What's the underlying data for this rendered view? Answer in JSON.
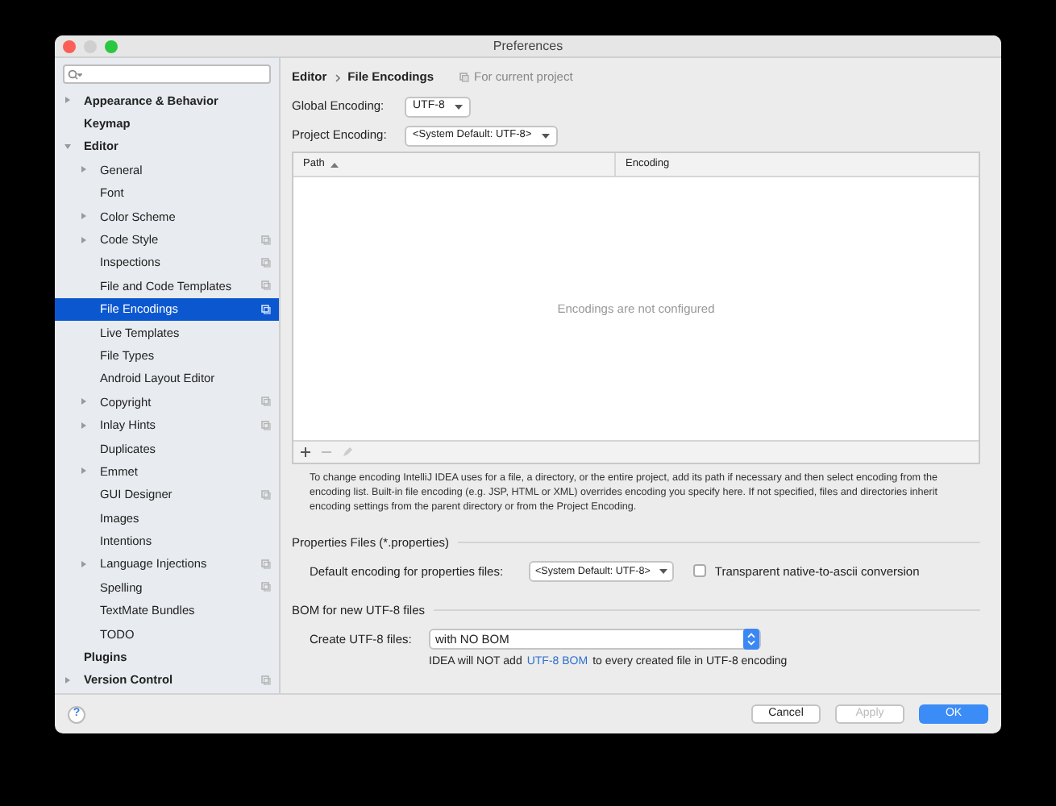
{
  "window": {
    "title": "Preferences"
  },
  "sidebar": {
    "items": [
      {
        "label": "Appearance & Behavior",
        "kind": "expandable",
        "expanded": false,
        "bold": true,
        "project_scoped": false,
        "selected": false
      },
      {
        "label": "Keymap",
        "kind": "leaf",
        "bold": true,
        "project_scoped": false,
        "selected": false
      },
      {
        "label": "Editor",
        "kind": "expandable",
        "expanded": true,
        "bold": true,
        "project_scoped": false,
        "selected": false,
        "children": [
          {
            "label": "General",
            "kind": "expandable",
            "expanded": false,
            "bold": false,
            "project_scoped": false,
            "selected": false
          },
          {
            "label": "Font",
            "kind": "leaf",
            "bold": false,
            "project_scoped": false,
            "selected": false
          },
          {
            "label": "Color Scheme",
            "kind": "expandable",
            "expanded": false,
            "bold": false,
            "project_scoped": false,
            "selected": false
          },
          {
            "label": "Code Style",
            "kind": "expandable",
            "expanded": false,
            "bold": false,
            "project_scoped": true,
            "selected": false
          },
          {
            "label": "Inspections",
            "kind": "leaf",
            "bold": false,
            "project_scoped": true,
            "selected": false
          },
          {
            "label": "File and Code Templates",
            "kind": "leaf",
            "bold": false,
            "project_scoped": true,
            "selected": false
          },
          {
            "label": "File Encodings",
            "kind": "leaf",
            "bold": false,
            "project_scoped": true,
            "selected": true
          },
          {
            "label": "Live Templates",
            "kind": "leaf",
            "bold": false,
            "project_scoped": false,
            "selected": false
          },
          {
            "label": "File Types",
            "kind": "leaf",
            "bold": false,
            "project_scoped": false,
            "selected": false
          },
          {
            "label": "Android Layout Editor",
            "kind": "leaf",
            "bold": false,
            "project_scoped": false,
            "selected": false
          },
          {
            "label": "Copyright",
            "kind": "expandable",
            "expanded": false,
            "bold": false,
            "project_scoped": true,
            "selected": false
          },
          {
            "label": "Inlay Hints",
            "kind": "expandable",
            "expanded": false,
            "bold": false,
            "project_scoped": true,
            "selected": false
          },
          {
            "label": "Duplicates",
            "kind": "leaf",
            "bold": false,
            "project_scoped": false,
            "selected": false
          },
          {
            "label": "Emmet",
            "kind": "expandable",
            "expanded": false,
            "bold": false,
            "project_scoped": false,
            "selected": false
          },
          {
            "label": "GUI Designer",
            "kind": "leaf",
            "bold": false,
            "project_scoped": true,
            "selected": false
          },
          {
            "label": "Images",
            "kind": "leaf",
            "bold": false,
            "project_scoped": false,
            "selected": false
          },
          {
            "label": "Intentions",
            "kind": "leaf",
            "bold": false,
            "project_scoped": false,
            "selected": false
          },
          {
            "label": "Language Injections",
            "kind": "expandable",
            "expanded": false,
            "bold": false,
            "project_scoped": true,
            "selected": false
          },
          {
            "label": "Spelling",
            "kind": "leaf",
            "bold": false,
            "project_scoped": true,
            "selected": false
          },
          {
            "label": "TextMate Bundles",
            "kind": "leaf",
            "bold": false,
            "project_scoped": false,
            "selected": false
          },
          {
            "label": "TODO",
            "kind": "leaf",
            "bold": false,
            "project_scoped": false,
            "selected": false
          }
        ]
      },
      {
        "label": "Plugins",
        "kind": "leaf",
        "bold": true,
        "project_scoped": false,
        "selected": false
      },
      {
        "label": "Version Control",
        "kind": "expandable",
        "expanded": false,
        "bold": true,
        "project_scoped": true,
        "selected": false
      }
    ]
  },
  "breadcrumb": [
    "Editor",
    "File Encodings"
  ],
  "scope_note": "For current project",
  "global_encoding": {
    "label": "Global Encoding:",
    "value": "UTF-8"
  },
  "project_encoding": {
    "label": "Project Encoding:",
    "value": "<System Default: UTF-8>"
  },
  "table": {
    "columns": [
      "Path",
      "Encoding"
    ],
    "empty_text": "Encodings are not configured"
  },
  "description": "To change encoding IntelliJ IDEA uses for a file, a directory, or the entire project, add its path if necessary and then select encoding from the encoding list. Built-in file encoding (e.g. JSP, HTML or XML) overrides encoding you specify here. If not specified, files and directories inherit encoding settings from the parent directory or from the Project Encoding.",
  "properties": {
    "title": "Properties Files (*.properties)",
    "label": "Default encoding for properties files:",
    "value": "<System Default: UTF-8>",
    "checkbox": {
      "label": "Transparent native-to-ascii conversion",
      "checked": false
    }
  },
  "bom": {
    "title": "BOM for new UTF-8 files",
    "label": "Create UTF-8 files:",
    "value": "with NO BOM",
    "note_before": "IDEA will NOT add",
    "note_link": "UTF-8 BOM",
    "note_after": "to every created file in UTF-8 encoding"
  },
  "help_button": "?",
  "buttons": [
    {
      "label": "Cancel",
      "kind": "normal",
      "disabled": false
    },
    {
      "label": "Apply",
      "kind": "normal",
      "disabled": true
    },
    {
      "label": "OK",
      "kind": "default",
      "disabled": false
    }
  ]
}
